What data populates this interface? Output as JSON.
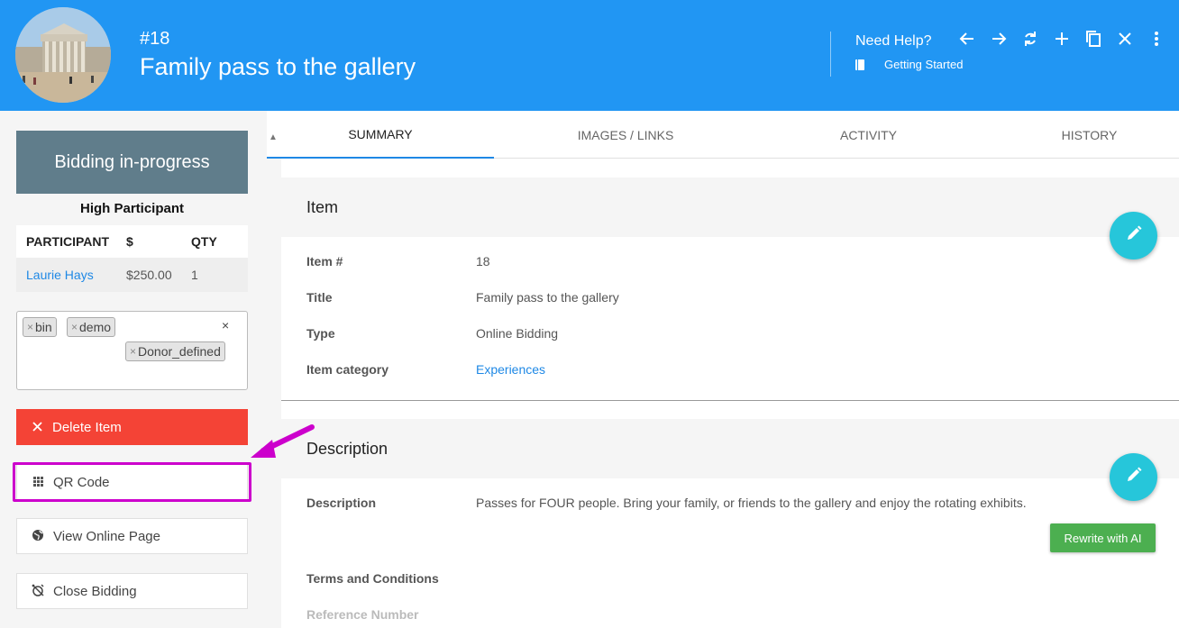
{
  "header": {
    "item_number": "#18",
    "title": "Family pass to the gallery",
    "help_title": "Need Help?",
    "help_link": "Getting Started",
    "icons": [
      "arrow-left-icon",
      "arrow-right-icon",
      "refresh-icon",
      "plus-icon",
      "copy-icon",
      "close-icon",
      "more-vert-icon"
    ]
  },
  "left": {
    "status": "Bidding in-progress",
    "high_participant_label": "High Participant",
    "table": {
      "headers": [
        "PARTICIPANT",
        "$",
        "QTY"
      ],
      "rows": [
        [
          "Laurie Hays",
          "$250.00",
          "1"
        ]
      ]
    },
    "tags": [
      "bin",
      "demo",
      "Donor_defined"
    ],
    "tags_clear": "×",
    "buttons": {
      "delete": "Delete Item",
      "qr": "QR Code",
      "view_online": "View Online Page",
      "close_bidding": "Close Bidding"
    }
  },
  "tabs": [
    "SUMMARY",
    "IMAGES / LINKS",
    "ACTIVITY",
    "HISTORY"
  ],
  "item_card": {
    "title": "Item",
    "fields": [
      {
        "label": "Item #",
        "value": "18"
      },
      {
        "label": "Title",
        "value": "Family pass to the gallery"
      },
      {
        "label": "Type",
        "value": "Online Bidding"
      },
      {
        "label": "Item category",
        "value": "Experiences"
      }
    ]
  },
  "description_card": {
    "title": "Description",
    "description_label": "Description",
    "description_value": "Passes for FOUR people. Bring your family, or friends to the gallery and enjoy the rotating exhibits.",
    "ai_button": "Rewrite with AI",
    "terms_label": "Terms and Conditions",
    "reference_label": "Reference Number"
  },
  "colors": {
    "header": "#2196f3",
    "status": "#607d8b",
    "delete": "#f44336",
    "fab": "#26c6da",
    "ai": "#4caf50",
    "highlight": "#cc00cc"
  }
}
